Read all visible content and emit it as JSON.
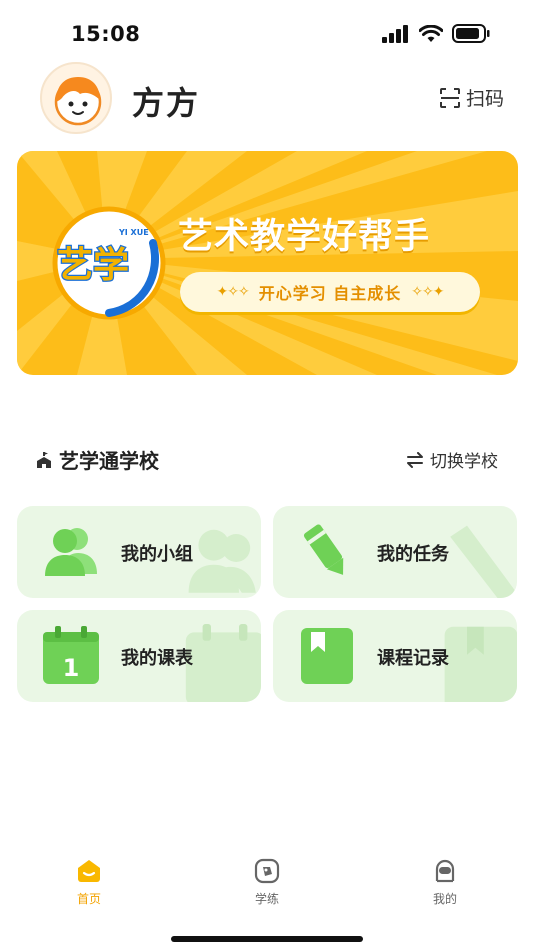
{
  "status_bar": {
    "time": "15:08"
  },
  "header": {
    "user_name": "方方",
    "scan_label": "扫码"
  },
  "banner": {
    "logo_text": "艺学",
    "logo_pinyin": "YI XUE",
    "title": "艺术教学好帮手",
    "slogan": "开心学习 自主成长",
    "colors": {
      "background": "#fdbd19",
      "rays": "#ffd24a"
    }
  },
  "school": {
    "name": "艺学通学校",
    "switch_label": "切换学校"
  },
  "cards": [
    {
      "label": "我的小组",
      "icon": "group-icon"
    },
    {
      "label": "我的任务",
      "icon": "pencil-icon"
    },
    {
      "label": "我的课表",
      "icon": "calendar-icon"
    },
    {
      "label": "课程记录",
      "icon": "bookmark-icon"
    }
  ],
  "tab_bar": {
    "tabs": [
      {
        "label": "首页",
        "icon": "home-icon",
        "active": true
      },
      {
        "label": "学练",
        "icon": "practice-icon",
        "active": false
      },
      {
        "label": "我的",
        "icon": "profile-icon",
        "active": false
      }
    ],
    "active_color": "#f3a300"
  },
  "colors": {
    "card_bg": "#eaf7e5",
    "card_icon": "#6fd156",
    "accent": "#fdbd19"
  }
}
